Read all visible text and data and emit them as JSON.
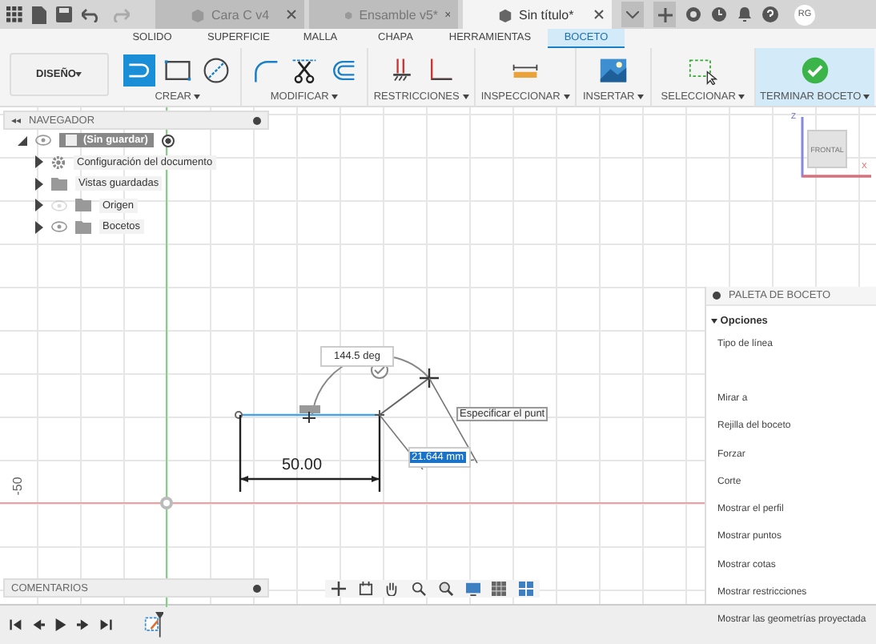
{
  "top_bar": {
    "doc_tabs": [
      {
        "label": "Cara C v4",
        "selected": false
      },
      {
        "label": "Ensamble v5*",
        "selected": false
      },
      {
        "label": "Sin título*",
        "selected": true
      }
    ],
    "user": "RG"
  },
  "ribbon": {
    "workspace": "DISEÑO",
    "tabs": [
      {
        "label": "SOLIDO",
        "selected": false
      },
      {
        "label": "SUPERFICIE",
        "selected": false
      },
      {
        "label": "MALLA",
        "selected": false
      },
      {
        "label": "CHAPA",
        "selected": false
      },
      {
        "label": "HERRAMIENTAS",
        "selected": false
      },
      {
        "label": "BOCETO",
        "selected": true
      }
    ],
    "groups": [
      {
        "label": "CREAR",
        "kind": "normal",
        "tools": [
          {
            "kind": "line",
            "selected": true
          },
          {
            "kind": "rectangle",
            "selected": false
          },
          {
            "kind": "circle",
            "selected": false
          }
        ]
      },
      {
        "label": "MODIFICAR",
        "kind": "normal",
        "tools": [
          {
            "kind": "fillet",
            "selected": false
          },
          {
            "kind": "trim",
            "selected": false
          },
          {
            "kind": "offset",
            "selected": false
          }
        ]
      },
      {
        "label": "RESTRICCIONES",
        "kind": "normal",
        "tools": [
          {
            "kind": "fix",
            "selected": false
          },
          {
            "kind": "perpendicular",
            "selected": false
          }
        ]
      },
      {
        "label": "INSPECCIONAR",
        "kind": "normal",
        "tools": [
          {
            "kind": "measure",
            "selected": false
          }
        ]
      },
      {
        "label": "INSERTAR",
        "kind": "normal",
        "tools": [
          {
            "kind": "image",
            "selected": false
          }
        ]
      },
      {
        "label": "SELECCIONAR",
        "kind": "normal",
        "tools": [
          {
            "kind": "select",
            "selected": false
          }
        ]
      },
      {
        "label": "TERMINAR BOCETO",
        "kind": "finish",
        "tools": [
          {
            "kind": "finish",
            "selected": false
          }
        ]
      }
    ]
  },
  "navigator": {
    "title": "NAVEGADOR",
    "root": {
      "label": "(Sin guardar)",
      "expanded": true,
      "children": [
        {
          "label": "Configuración del documento",
          "kind": "settings"
        },
        {
          "label": "Vistas guardadas",
          "kind": "folder"
        },
        {
          "label": "Origen",
          "kind": "folder",
          "visible": false
        },
        {
          "label": "Bocetos",
          "kind": "folder",
          "visible": true
        }
      ]
    }
  },
  "canvas": {
    "axis_label": "-50",
    "sketch": {
      "dimension": "50.00",
      "angle": "144.5 deg",
      "length_input": "21.644 mm",
      "tooltip": "Especificar el punt"
    },
    "view_cube": {
      "face": "FRONTAL",
      "z_label": "Z",
      "x_label": "X"
    }
  },
  "sketch_palette": {
    "title": "PALETA DE BOCETO",
    "section": {
      "label": "Opciones",
      "expanded": true
    },
    "options": [
      "Tipo de línea",
      "Mirar a",
      "Rejilla del boceto",
      "Forzar",
      "Corte",
      "Mostrar el perfil",
      "Mostrar puntos",
      "Mostrar cotas",
      "Mostrar restricciones",
      "Mostrar las geometrías proyectada"
    ]
  },
  "comments": {
    "title": "COMENTARIOS"
  }
}
